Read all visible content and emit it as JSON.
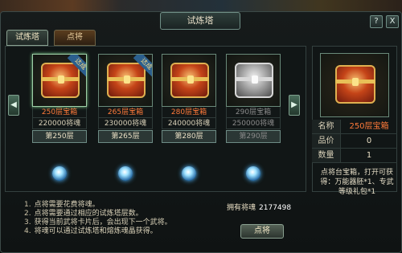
{
  "window": {
    "title": "试炼塔",
    "help_label": "?",
    "close_label": "X"
  },
  "tabs": [
    {
      "label": "试炼塔",
      "active": true
    },
    {
      "label": "点将",
      "active": false
    }
  ],
  "cards": [
    {
      "name": "250层宝箱",
      "cost": "220000将魂",
      "floor": "第250层",
      "badge": "达成",
      "state": "achieved"
    },
    {
      "name": "265层宝箱",
      "cost": "230000将魂",
      "floor": "第265层",
      "badge": "达成",
      "state": "achieved"
    },
    {
      "name": "280层宝箱",
      "cost": "240000将魂",
      "floor": "第280层",
      "badge": "",
      "state": "available"
    },
    {
      "name": "290层宝箱",
      "cost": "250000将魂",
      "floor": "第290层",
      "badge": "",
      "state": "locked"
    }
  ],
  "nav": {
    "prev_label": "◀",
    "next_label": "▶"
  },
  "detail": {
    "name_key": "名称",
    "name_value": "250层宝箱",
    "quality_key": "品价",
    "quality_value": "0",
    "qty_key": "数量",
    "qty_value": "1",
    "description": "点将台宝箱，打开可获得：万能器胚*1、专武等级礼包*1"
  },
  "tips": [
    {
      "n": "1.",
      "text": "点将需要花费将魂。"
    },
    {
      "n": "2.",
      "text": "点将需要通过相应的试炼塔层数。"
    },
    {
      "n": "3.",
      "text": "获得当前武将卡片后，会出现下一个武将。"
    },
    {
      "n": "4.",
      "text": "将魂可以通过试炼塔和熔炼魂晶获得。"
    }
  ],
  "soul": {
    "label": "拥有将魂",
    "value": "2177498"
  },
  "action_button_label": "点将"
}
